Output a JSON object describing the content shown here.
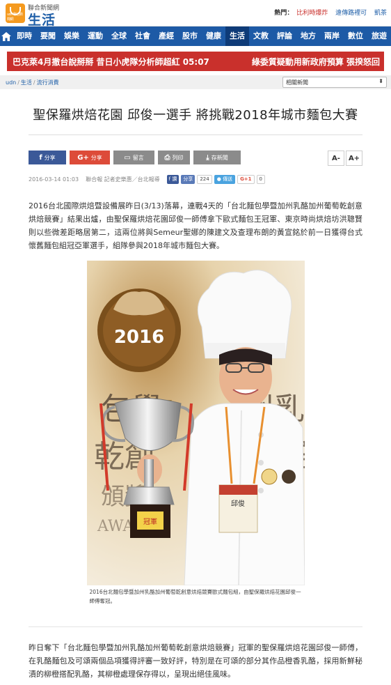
{
  "header": {
    "logo_tag": "udn 聯合新聞網",
    "brand_small": "聯合新聞網",
    "brand_big": "生活",
    "hot_label": "熱門：",
    "hot_link": "比利時爆炸",
    "links": [
      "遠傳路裡可",
      "凱茶"
    ]
  },
  "nav": {
    "items": [
      "即時",
      "要聞",
      "娛樂",
      "運動",
      "全球",
      "社會",
      "產經",
      "股市",
      "健康",
      "生活",
      "文教",
      "評論",
      "地方",
      "兩岸",
      "數位",
      "旅遊"
    ],
    "active": "生活"
  },
  "ticker": {
    "left": "巴克萊4月撤台說掰掰 昔日小虎隊分析師超紅 05:07",
    "right": "綠委質疑動用新政府預算 張揆怒回"
  },
  "breadcrumb": {
    "items": [
      "udn",
      "生活",
      "流行消費"
    ],
    "select_value": "相關新聞"
  },
  "article": {
    "title": "聖保羅烘焙花園 邱俊一選手 將挑戰2018年城市麵包大賽",
    "share": {
      "fb": "分享",
      "gplus": "分享",
      "message": "留言",
      "print": "列印",
      "save": "存新聞",
      "font_small": "A-",
      "font_large": "A+"
    },
    "meta": {
      "date": "2016-03-14 01:03",
      "source": "聯合報 記者史樂惠／台北報導",
      "fb_label": "讚",
      "share_label": "分享",
      "share_count": "224",
      "tweet_label": "傳送",
      "g1_label": "G+1",
      "g1_count": "0"
    },
    "paragraph1": "2016台北國際烘焙暨設備展昨日(3/13)落幕，連戰4天的「台北麵包學暨加州乳酪加州葡萄乾創意烘焙競賽」結果出爐，由聖保羅烘焙花園邱俊一師傅拿下歐式麵包王冠軍、東京時尚烘焙坊洪聰賢則以些微差距略居第二，這兩位將與Semeur聖娜的陳建文及查理布朗的黃宣銘於前一日獲得台式懷舊麵包組冠亞軍選手，組隊參與2018年城市麵包大賽。",
    "photo": {
      "sign_year": "2016",
      "wall_text": [
        "包學",
        "暨",
        "州乳",
        "乾創",
        "烘焙",
        "頒獎",
        "AWARD"
      ],
      "cup_label": "冠軍",
      "badge_text": "邱俊"
    },
    "caption": "2016台北麵包學暨加州乳酪加州葡萄乾創意烘焙競賽歐式麵包組，由聖保羅烘焙花園邱俊一師傅奪冠。",
    "paragraph2": "昨日奪下「台北麵包學暨加州乳酪加州葡萄乾創意烘焙競賽」冠軍的聖保羅烘焙花園邱俊一師傅，在乳酪麵包及可頌兩個品項獲得評審一致好評，特別是在可頌的部分其作品橙香乳酪，採用新鮮秘漬的柳橙搭配乳酪，其柳橙處理保存得以，呈現出絕佳風味。"
  },
  "colors": {
    "nav_bg": "#1d5aa6",
    "ticker_bg": "#c9302c",
    "brand": "#1f5fa8",
    "fb": "#3b5998",
    "gplus": "#dd4b39"
  }
}
